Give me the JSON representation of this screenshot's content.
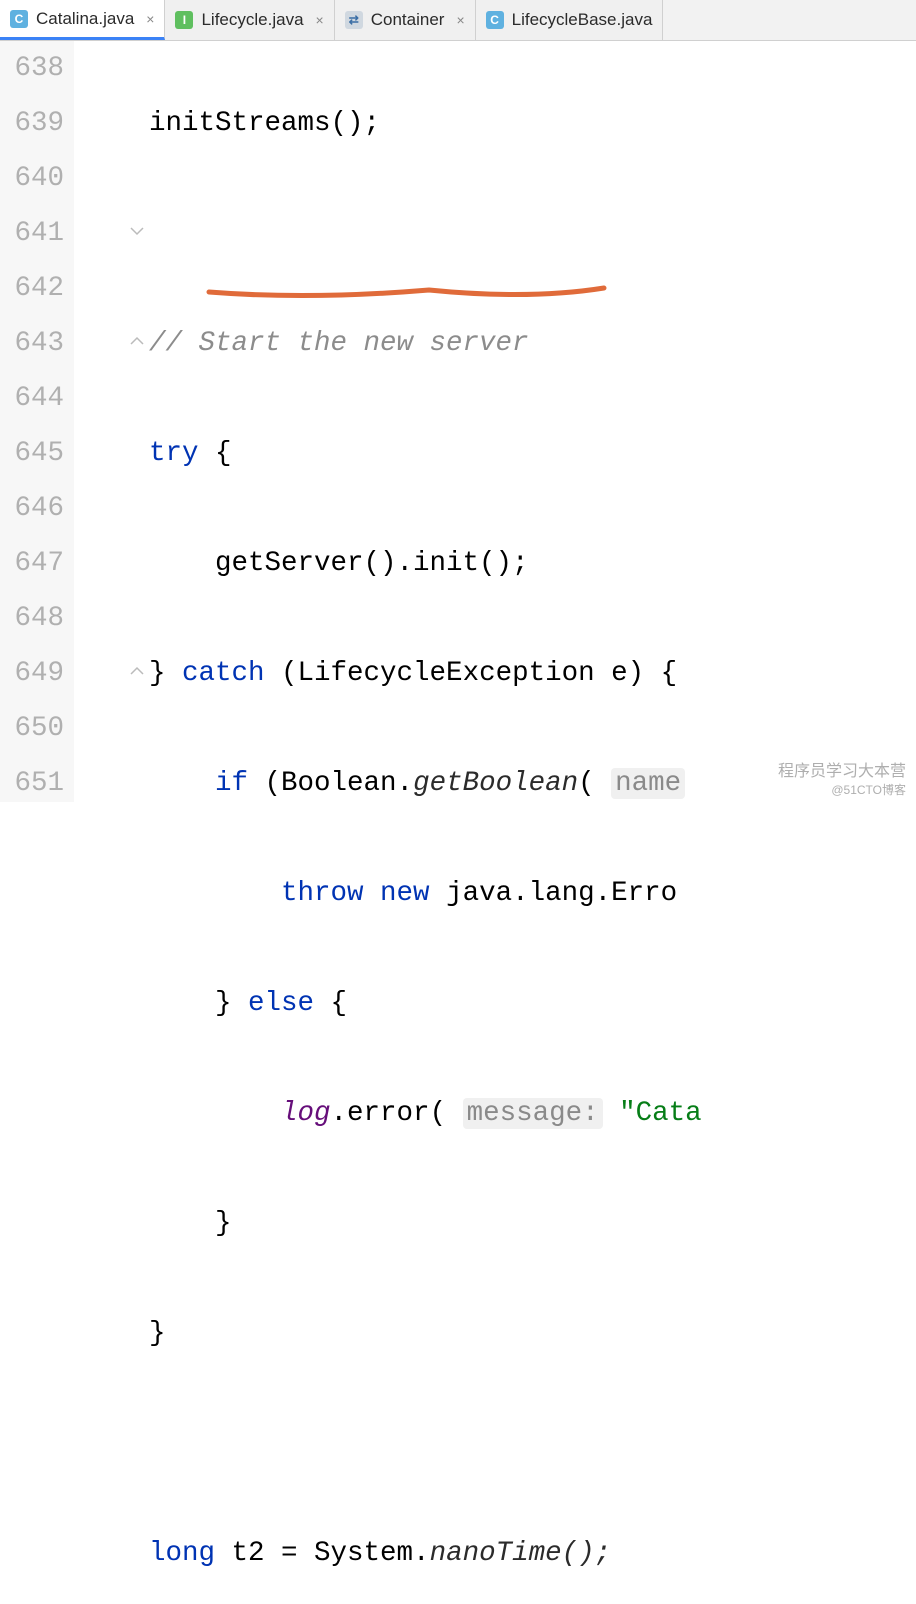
{
  "tabs": [
    {
      "label": "Catalina.java",
      "icon": "C",
      "iconClass": "class",
      "active": true
    },
    {
      "label": "Lifecycle.java",
      "icon": "I",
      "iconClass": "interface",
      "active": false
    },
    {
      "label": "Container",
      "icon": "⇄",
      "iconClass": "container",
      "active": false
    },
    {
      "label": "LifecycleBase.java",
      "icon": "C",
      "iconClass": "class",
      "active": false
    }
  ],
  "lines": {
    "l638": "638",
    "l639": "639",
    "l640": "640",
    "l641": "641",
    "l642": "642",
    "l643": "643",
    "l644": "644",
    "l645": "645",
    "l646": "646",
    "l647": "647",
    "l648": "648",
    "l649": "649",
    "l650": "650",
    "l651": "651"
  },
  "code": {
    "l638": "initStreams();",
    "l639": "",
    "l640_comment": "// Start the new server",
    "l641_try": "try",
    "l641_brace": " {",
    "l642": "    getServer().init();",
    "l643_brace": "} ",
    "l643_catch": "catch",
    "l643_params": " (LifecycleException e) {",
    "l644_if": "if",
    "l644_paren": " (Boolean.",
    "l644_method": "getBoolean",
    "l644_open": "( ",
    "l644_hint": "name",
    "l645_throw": "throw new",
    "l645_rest": " java.lang.Erro",
    "l646_brace": "} ",
    "l646_else": "else",
    "l646_open": " {",
    "l647_log": "log",
    "l647_err": ".error( ",
    "l647_hint": "message:",
    "l647_str": " \"Cata",
    "l648": "}",
    "l649": "}",
    "l650": "",
    "l651_long": "long",
    "l651_t2": " t2 = System.",
    "l651_nano": "nanoTime();"
  },
  "watermark": {
    "main": "程序员学习大本营",
    "sub": "@51CTO博客"
  }
}
